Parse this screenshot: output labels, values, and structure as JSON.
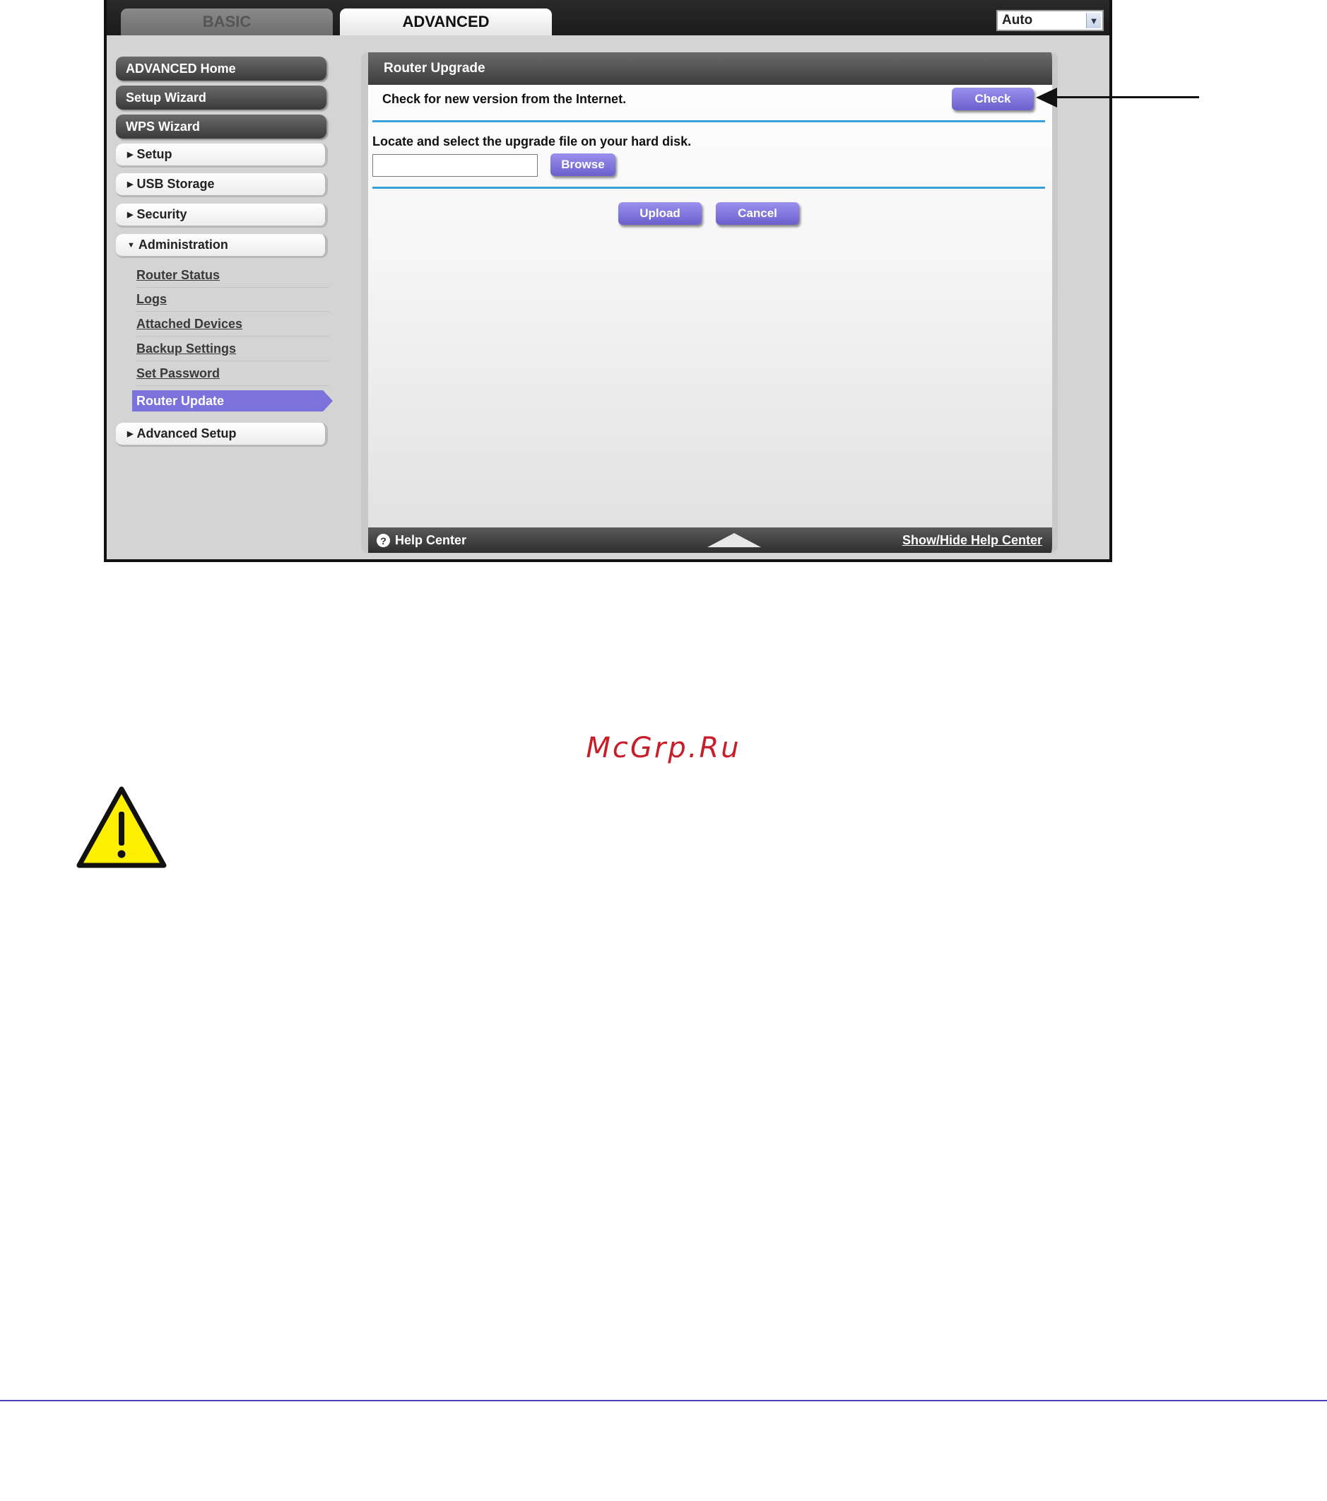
{
  "tabs": {
    "basic": "BASIC",
    "advanced": "ADVANCED"
  },
  "language_select": {
    "value": "Auto"
  },
  "sidebar": {
    "dark_items": [
      "ADVANCED Home",
      "Setup Wizard",
      "WPS Wizard"
    ],
    "sections": [
      "Setup",
      "USB Storage",
      "Security",
      "Administration"
    ],
    "admin_links": [
      "Router Status",
      "Logs",
      "Attached Devices",
      "Backup Settings",
      "Set Password"
    ],
    "active_link": "Router Update",
    "advanced_setup": "Advanced Setup"
  },
  "panel": {
    "title": "Router Upgrade",
    "check_text": "Check for new version from the Internet.",
    "check_button": "Check",
    "locate_text": "Locate and select the upgrade file on your hard disk.",
    "browse_button": "Browse",
    "upload_button": "Upload",
    "cancel_button": "Cancel"
  },
  "help": {
    "label": "Help Center",
    "toggle_link": "Show/Hide Help Center"
  },
  "watermark": "McGrp.Ru",
  "colors": {
    "accent_purple": "#7b72dc",
    "divider_blue": "#3aa0d8",
    "footer_rule": "#4a3fbf",
    "watermark_red": "#c81e2a"
  }
}
